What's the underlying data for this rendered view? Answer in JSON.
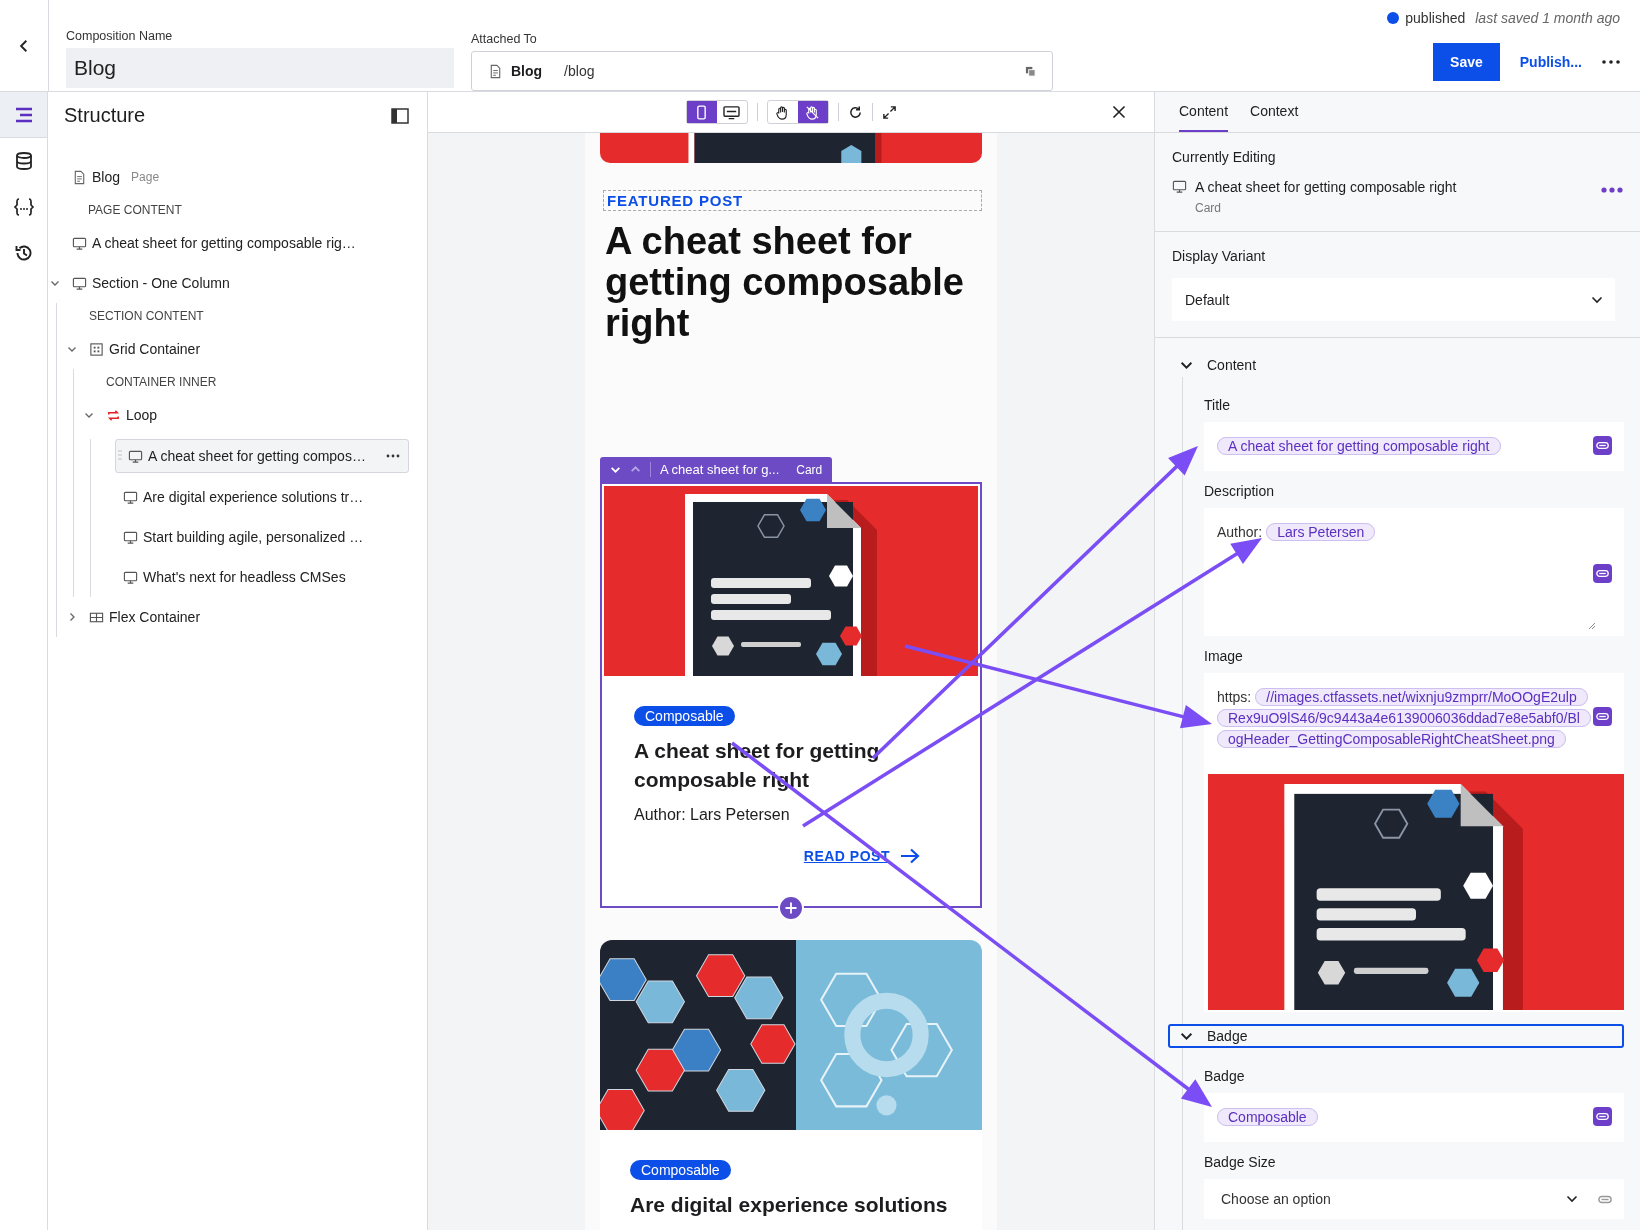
{
  "header": {
    "composition_name_label": "Composition Name",
    "composition_name": "Blog",
    "attached_to_label": "Attached To",
    "attached_page": "Blog",
    "attached_path": "/blog",
    "status": "published",
    "last_saved": "last saved 1 month ago",
    "save": "Save",
    "publish": "Publish..."
  },
  "rail": [
    {
      "kind": "structure",
      "selected": true
    },
    {
      "kind": "data",
      "selected": false
    },
    {
      "kind": "parameters",
      "selected": false
    },
    {
      "kind": "history",
      "selected": false
    }
  ],
  "sidebar": {
    "title": "Structure",
    "tree": [
      {
        "kind": "page",
        "label": "Blog",
        "type_label": "Page",
        "selected": false
      },
      {
        "kind": "slot",
        "label": "PAGE CONTENT",
        "children": [
          {
            "kind": "component",
            "label": "A cheat sheet for getting composable rig…",
            "selected": false
          },
          {
            "kind": "component",
            "label": "Section - One Column",
            "selected": false,
            "expanded": true,
            "children": [
              {
                "kind": "slot",
                "label": "SECTION CONTENT",
                "children": [
                  {
                    "kind": "grid",
                    "label": "Grid Container",
                    "selected": false,
                    "expanded": true,
                    "children": [
                      {
                        "kind": "slot",
                        "label": "CONTAINER INNER",
                        "children": [
                          {
                            "kind": "loop",
                            "label": "Loop",
                            "selected": false,
                            "expanded": true,
                            "children": [
                              {
                                "kind": "component",
                                "label": "A cheat sheet for getting compos…",
                                "selected": true
                              },
                              {
                                "kind": "component",
                                "label": "Are digital experience solutions tr…",
                                "selected": false
                              },
                              {
                                "kind": "component",
                                "label": "Start building agile, personalized …",
                                "selected": false
                              },
                              {
                                "kind": "component",
                                "label": "What's next for headless CMSes",
                                "selected": false
                              }
                            ]
                          }
                        ]
                      }
                    ]
                  },
                  {
                    "kind": "flex",
                    "label": "Flex Container",
                    "selected": false,
                    "expanded": false
                  }
                ]
              }
            ]
          }
        ]
      }
    ]
  },
  "preview": {
    "viewports": [
      {
        "kind": "mobile",
        "selected": true
      },
      {
        "kind": "desktop",
        "selected": false
      }
    ],
    "modes": [
      {
        "kind": "hand",
        "selected": false
      },
      {
        "kind": "pointer",
        "selected": true
      }
    ],
    "featured_label": "FEATURED POST",
    "hero_title": "A cheat sheet for getting composable right",
    "cards": [
      {
        "selected": true,
        "toolbar_title": "A cheat sheet for g...",
        "toolbar_type": "Card",
        "badge": "Composable",
        "title": "A cheat sheet for getting composable right",
        "description": "Author: Lars Petersen",
        "link": "READ POST"
      },
      {
        "selected": false,
        "badge": "Composable",
        "title": "Are digital experience solutions"
      }
    ]
  },
  "inspector": {
    "tabs": [
      {
        "label": "Content",
        "selected": true
      },
      {
        "label": "Context",
        "selected": false
      }
    ],
    "currently_editing_label": "Currently Editing",
    "editing_title": "A cheat sheet for getting composable right",
    "editing_type": "Card",
    "display_variant_label": "Display Variant",
    "display_variant": "Default",
    "sections": [
      {
        "title": "Content",
        "expanded": true,
        "focused": false,
        "fields": [
          {
            "kind": "text",
            "label": "Title",
            "value": "A cheat sheet for getting composable right"
          },
          {
            "kind": "richtext",
            "label": "Description",
            "prefix": "Author:",
            "value": "Lars Petersen"
          },
          {
            "label": "Image",
            "prefix": "https:",
            "value": "//images.ctfassets.net/wixnju9zmprr/MoOOgE2ulpRex9uO9lS46/9c9443a4e6139006036ddad7e8e5abf0/BlogHeader_GettingComposableRightCheatSheet.png"
          }
        ]
      },
      {
        "title": "Badge",
        "expanded": true,
        "focused": true,
        "fields": [
          {
            "kind": "text",
            "label": "Badge",
            "value": "Composable"
          },
          {
            "kind": "select",
            "label": "Badge Size",
            "placeholder": "Choose an option"
          }
        ]
      }
    ]
  }
}
